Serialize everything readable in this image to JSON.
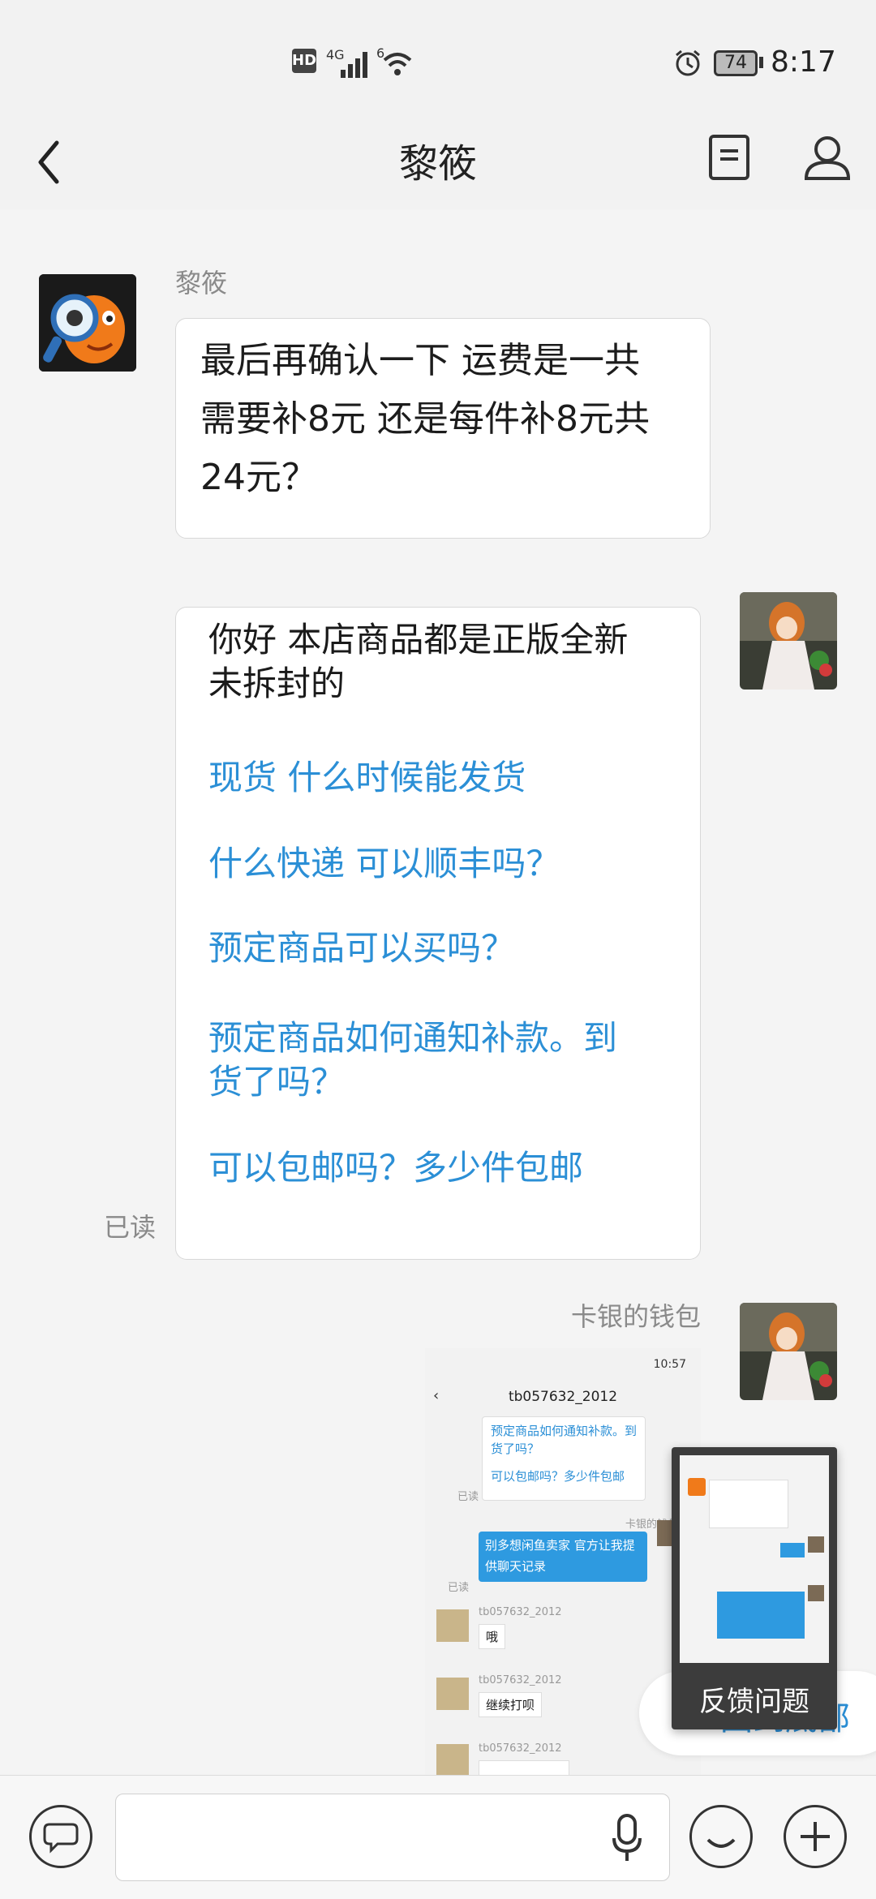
{
  "status_bar": {
    "network_hd": "HD",
    "network_4g": "4G",
    "network_6": "6",
    "battery": "74",
    "time": "8:17"
  },
  "header": {
    "title": "黎筱",
    "back_icon": "chevron-left-icon",
    "menu_icon": "document-icon",
    "profile_icon": "person-icon"
  },
  "messages": {
    "m1": {
      "sender": "黎筱",
      "text_line1": "最后再确认一下 运费是一共",
      "text_line2": "需要补8元 还是每件补8元共",
      "text_line3": "24元？"
    },
    "m2": {
      "intro_line1": "你好 本店商品都是正版全新",
      "intro_line2": "未拆封的",
      "links": {
        "q1": "现货 什么时候能发货",
        "q2": "什么快递  可以顺丰吗？",
        "q3": "预定商品可以买吗？",
        "q4_line1": "预定商品如何通知补款。到",
        "q4_line2": "货了吗？",
        "q5": "可以包邮吗？多少件包邮"
      },
      "read_status": "已读"
    },
    "m3": {
      "sender": "卡银的钱包"
    }
  },
  "screenshot_image": {
    "time": "10:57",
    "title": "tb057632_2012",
    "q4_line1": "预定商品如何通知补款。到",
    "q4_line2": "货了吗？",
    "q5": "可以包邮吗？多少件包邮",
    "read1": "已读",
    "sender": "卡银的钱包",
    "bubble_line1": "别多想闲鱼卖家 官方让我提",
    "bubble_line2": "供聊天记录",
    "read2": "已读",
    "name1": "tb057632_2012",
    "reply1": "哦",
    "name2": "tb057632_2012",
    "reply2": "继续打呗",
    "name3": "tb057632_2012"
  },
  "feedback": {
    "label": "反馈问题",
    "behind_label": "回到底部"
  },
  "input_bar": {
    "chat_icon": "speech-bubble-icon",
    "mic_icon": "microphone-icon",
    "emoji_icon": "smiley-icon",
    "add_icon": "plus-icon"
  }
}
